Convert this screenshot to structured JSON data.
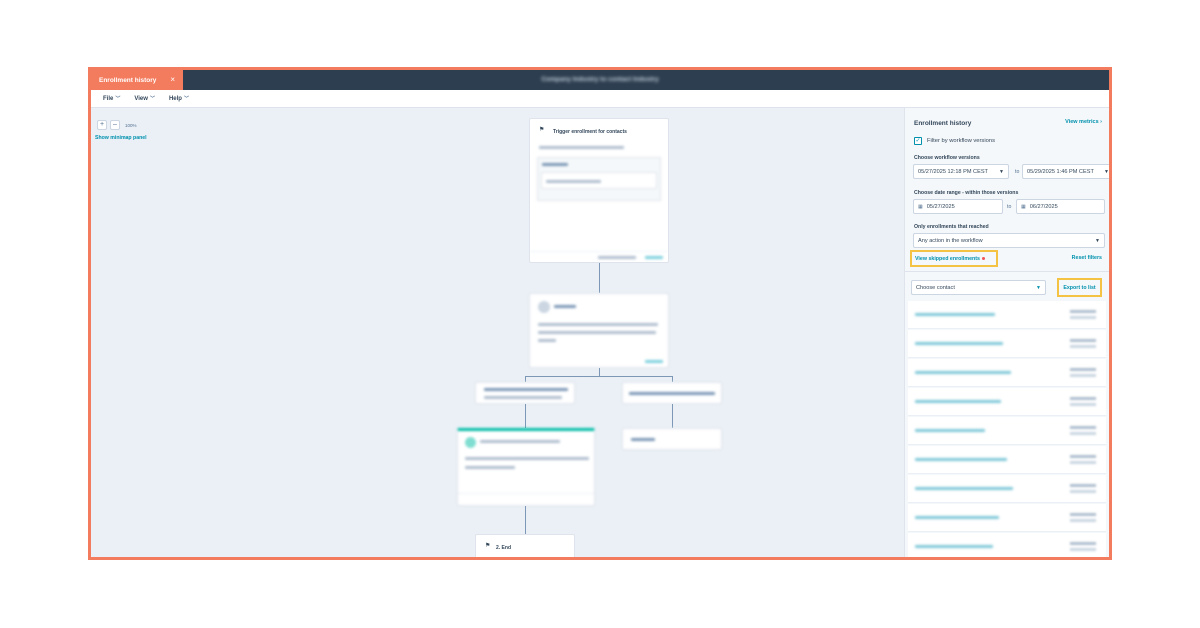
{
  "tab": {
    "label": "Enrollment history",
    "close": "×"
  },
  "workflow_title": "Company Industry to contact Industry",
  "menu": [
    {
      "label": "File"
    },
    {
      "label": "View"
    },
    {
      "label": "Help"
    }
  ],
  "canvas": {
    "zoom_in": "+",
    "zoom_out": "–",
    "zoom_level": "100%",
    "minimap": "Show minimap panel",
    "trigger_title": "Trigger enrollment for contacts",
    "end_label": "2. End"
  },
  "panel": {
    "title": "Enrollment history",
    "view_metrics": "View metrics",
    "filter_versions": "Filter by workflow versions",
    "choose_versions_label": "Choose workflow versions",
    "version_from": "05/27/2025 12:18 PM CEST",
    "version_to": "05/29/2025 1:46 PM CEST",
    "to": "to",
    "date_range_label": "Choose date range - within those versions",
    "date_from": "05/27/2025",
    "date_to": "06/27/2025",
    "reached_label": "Only enrollments that reached",
    "reached_value": "Any action in the workflow",
    "view_skipped": "View skipped enrollments",
    "reset_filters": "Reset filters",
    "choose_contact": "Choose contact",
    "export": "Export to list"
  }
}
